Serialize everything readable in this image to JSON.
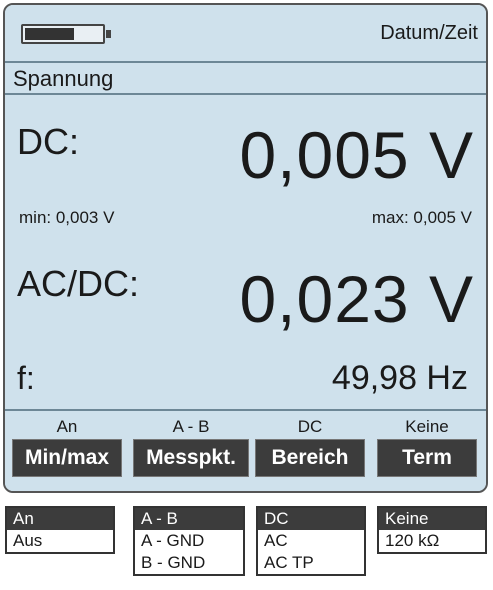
{
  "status": {
    "datetime": "Datum/Zeit",
    "battery_level": 0.65
  },
  "mode_title": "Spannung",
  "readings": {
    "dc_label": "DC:",
    "dc_value": "0,005 V",
    "min": "min: 0,003 V",
    "max": "max: 0,005 V",
    "acdc_label": "AC/DC:",
    "acdc_value": "0,023 V",
    "f_label": "f:",
    "f_value": "49,98 Hz"
  },
  "softkeys": [
    {
      "state": "An",
      "label": "Min/max"
    },
    {
      "state": "A - B",
      "label": "Messpkt."
    },
    {
      "state": "DC",
      "label": "Bereich"
    },
    {
      "state": "Keine",
      "label": "Term"
    }
  ],
  "menus": [
    {
      "items": [
        "An",
        "Aus"
      ],
      "selected": 0
    },
    {
      "items": [
        "A - B",
        "A - GND",
        "B - GND"
      ],
      "selected": 0
    },
    {
      "items": [
        "DC",
        "AC",
        "AC TP"
      ],
      "selected": 0
    },
    {
      "items": [
        "Keine",
        "120 kΩ"
      ],
      "selected": 0
    }
  ]
}
